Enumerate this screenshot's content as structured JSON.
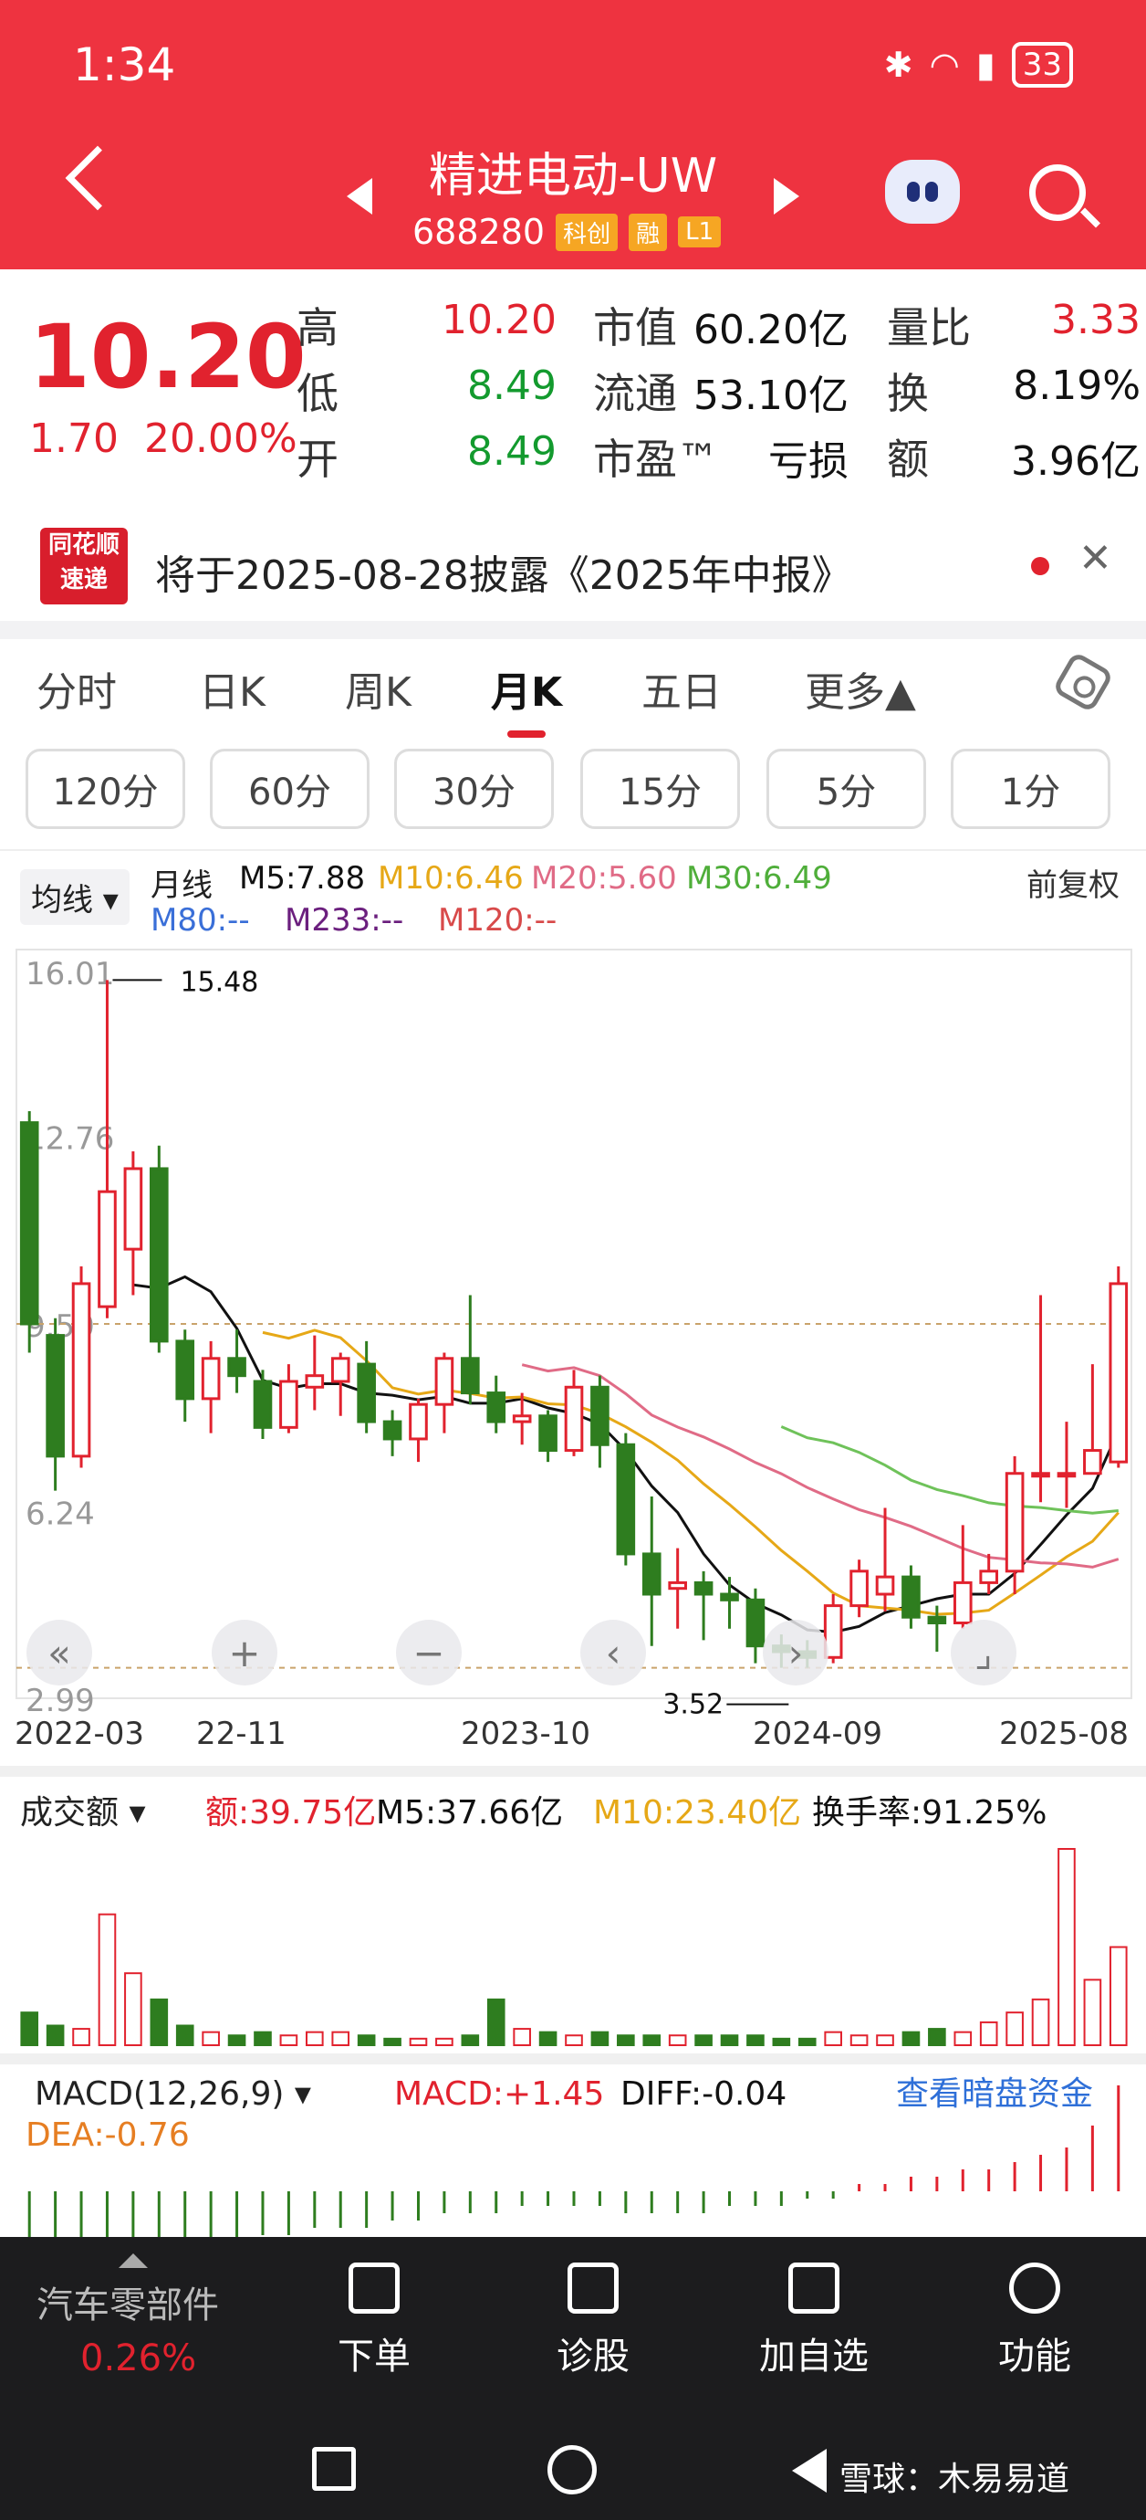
{
  "status_bar": {
    "time": "1:34",
    "battery": "33"
  },
  "header": {
    "stock_name": "精进电动-UW",
    "code": "688280",
    "tags": [
      "科创",
      "融",
      "L1"
    ]
  },
  "quote": {
    "price": "10.20",
    "change": "1.70",
    "change_pct": "20.00%",
    "high_label": "高",
    "high": "10.20",
    "low_label": "低",
    "low": "8.49",
    "open_label": "开",
    "open": "8.49",
    "mktcap_label": "市值",
    "mktcap": "60.20亿",
    "float_label": "流通",
    "float": "53.10亿",
    "pe_label": "市盈™",
    "pe": "亏损",
    "vr_label": "量比",
    "vr": "3.33",
    "turnover_label": "换",
    "turnover": "8.19%",
    "amount_label": "额",
    "amount": "3.96亿"
  },
  "news": {
    "logo_top": "同花顺",
    "logo_bottom": "速递",
    "text": "将于2025-08-28披露《2025年中报》"
  },
  "tabs": [
    "分时",
    "日K",
    "周K",
    "月K",
    "五日",
    "更多▲"
  ],
  "minute_buttons": [
    "120分",
    "60分",
    "30分",
    "15分",
    "5分",
    "1分"
  ],
  "legend": {
    "selector": "均线 ▾",
    "type": "月线",
    "fq": "前复权",
    "m5": "M5:7.88",
    "m10": "M10:6.46",
    "m20": "M20:5.60",
    "m30": "M30:6.49",
    "m80": "M80:--",
    "m233": "M233:--",
    "m120": "M120:--"
  },
  "colors": {
    "up": "#e1222e",
    "down": "#2e7d1f",
    "m5": "#111111",
    "m10": "#e6a817",
    "m20": "#e06b86",
    "m30": "#6fc25a",
    "bg_header": "#ee3340"
  },
  "chart_data": {
    "type": "candlestick",
    "ylim": [
      2.99,
      16.01
    ],
    "y_ticks": [
      "16.01",
      "12.76",
      "9.50",
      "6.24",
      "2.99"
    ],
    "x_ticks": [
      "2022-03",
      "22-11",
      "2023-10",
      "2024-09",
      "2025-08"
    ],
    "annotations": {
      "high": "15.48",
      "low": "3.52"
    },
    "candles": [
      {
        "o": 13.0,
        "c": 9.5,
        "h": 13.2,
        "l": 9.0
      },
      {
        "o": 9.3,
        "c": 7.2,
        "h": 9.6,
        "l": 6.6
      },
      {
        "o": 7.2,
        "c": 10.2,
        "h": 10.5,
        "l": 7.0
      },
      {
        "o": 9.8,
        "c": 11.8,
        "h": 15.48,
        "l": 9.6
      },
      {
        "o": 10.8,
        "c": 12.2,
        "h": 12.5,
        "l": 10.0
      },
      {
        "o": 12.2,
        "c": 9.2,
        "h": 12.6,
        "l": 9.0
      },
      {
        "o": 9.2,
        "c": 8.2,
        "h": 9.4,
        "l": 7.8
      },
      {
        "o": 8.2,
        "c": 8.9,
        "h": 9.2,
        "l": 7.6
      },
      {
        "o": 8.9,
        "c": 8.6,
        "h": 9.4,
        "l": 8.3
      },
      {
        "o": 8.5,
        "c": 7.7,
        "h": 8.7,
        "l": 7.5
      },
      {
        "o": 7.7,
        "c": 8.5,
        "h": 8.8,
        "l": 7.6
      },
      {
        "o": 8.4,
        "c": 8.6,
        "h": 9.3,
        "l": 8.0
      },
      {
        "o": 8.5,
        "c": 8.9,
        "h": 9.0,
        "l": 7.9
      },
      {
        "o": 8.8,
        "c": 7.8,
        "h": 9.2,
        "l": 7.6
      },
      {
        "o": 7.8,
        "c": 7.5,
        "h": 8.0,
        "l": 7.2
      },
      {
        "o": 7.5,
        "c": 8.1,
        "h": 8.2,
        "l": 7.1
      },
      {
        "o": 8.1,
        "c": 8.9,
        "h": 9.0,
        "l": 7.6
      },
      {
        "o": 8.9,
        "c": 8.3,
        "h": 10.0,
        "l": 8.1
      },
      {
        "o": 8.3,
        "c": 7.8,
        "h": 8.6,
        "l": 7.6
      },
      {
        "o": 7.8,
        "c": 7.9,
        "h": 8.3,
        "l": 7.4
      },
      {
        "o": 7.9,
        "c": 7.3,
        "h": 8.0,
        "l": 7.1
      },
      {
        "o": 7.3,
        "c": 8.4,
        "h": 8.7,
        "l": 7.2
      },
      {
        "o": 8.4,
        "c": 7.4,
        "h": 8.6,
        "l": 7.0
      },
      {
        "o": 7.4,
        "c": 5.5,
        "h": 7.6,
        "l": 5.3
      },
      {
        "o": 5.5,
        "c": 4.8,
        "h": 6.5,
        "l": 3.9
      },
      {
        "o": 4.9,
        "c": 5.0,
        "h": 5.6,
        "l": 4.2
      },
      {
        "o": 5.0,
        "c": 4.8,
        "h": 5.2,
        "l": 4.0
      },
      {
        "o": 4.8,
        "c": 4.7,
        "h": 5.1,
        "l": 4.2
      },
      {
        "o": 4.7,
        "c": 3.9,
        "h": 4.9,
        "l": 3.6
      },
      {
        "o": 3.9,
        "c": 3.8,
        "h": 4.1,
        "l": 3.52
      },
      {
        "o": 3.8,
        "c": 3.7,
        "h": 4.0,
        "l": 3.52
      },
      {
        "o": 3.7,
        "c": 4.6,
        "h": 4.8,
        "l": 3.6
      },
      {
        "o": 4.6,
        "c": 5.2,
        "h": 5.4,
        "l": 4.4
      },
      {
        "o": 4.8,
        "c": 5.1,
        "h": 6.3,
        "l": 4.5
      },
      {
        "o": 5.1,
        "c": 4.4,
        "h": 5.3,
        "l": 4.2
      },
      {
        "o": 4.4,
        "c": 4.3,
        "h": 4.6,
        "l": 3.8
      },
      {
        "o": 4.3,
        "c": 5.0,
        "h": 6.0,
        "l": 4.2
      },
      {
        "o": 5.0,
        "c": 5.2,
        "h": 5.5,
        "l": 4.8
      },
      {
        "o": 5.2,
        "c": 6.9,
        "h": 7.2,
        "l": 4.8
      },
      {
        "o": 6.9,
        "c": 6.9,
        "h": 10.0,
        "l": 6.4
      },
      {
        "o": 6.9,
        "c": 6.9,
        "h": 7.8,
        "l": 6.3
      },
      {
        "o": 6.9,
        "c": 7.3,
        "h": 8.8,
        "l": 7.0
      },
      {
        "o": 7.1,
        "c": 10.2,
        "h": 10.5,
        "l": 7.0
      }
    ],
    "volume": {
      "label": "成交额",
      "amount": "额:39.75亿",
      "m5": "M5:37.66亿",
      "m10": "M10:23.40亿",
      "turnover": "换手率:91.25%",
      "values": [
        10,
        6,
        5,
        40,
        22,
        14,
        6,
        4,
        3,
        4,
        3,
        4,
        4,
        3,
        2,
        2,
        2,
        3,
        14,
        5,
        4,
        3,
        4,
        3,
        3,
        3,
        3,
        3,
        3,
        2,
        2,
        4,
        3,
        3,
        4,
        5,
        4,
        7,
        10,
        14,
        60,
        20,
        30
      ]
    },
    "macd": {
      "label": "MACD(12,26,9) ▾",
      "macd": "MACD:+1.45",
      "diff": "DIFF:-0.04",
      "dea": "DEA:-0.76",
      "link": "查看暗盘资金",
      "values": [
        -1.0,
        -1.1,
        -1.1,
        -1.0,
        -0.9,
        -0.8,
        -0.8,
        -0.7,
        -0.7,
        -0.6,
        -0.6,
        -0.5,
        -0.5,
        -0.5,
        -0.4,
        -0.4,
        -0.3,
        -0.3,
        -0.3,
        -0.2,
        -0.2,
        -0.2,
        -0.2,
        -0.3,
        -0.3,
        -0.3,
        -0.3,
        -0.2,
        -0.2,
        -0.2,
        -0.1,
        -0.1,
        0.1,
        0.1,
        0.2,
        0.2,
        0.3,
        0.3,
        0.4,
        0.5,
        0.6,
        0.9,
        1.45
      ]
    }
  },
  "nav": {
    "sector": "汽车零部件",
    "sector_pct": "0.26%",
    "items": [
      "下单",
      "诊股",
      "加自选",
      "功能"
    ]
  },
  "watermark": "雪球：木易易道"
}
